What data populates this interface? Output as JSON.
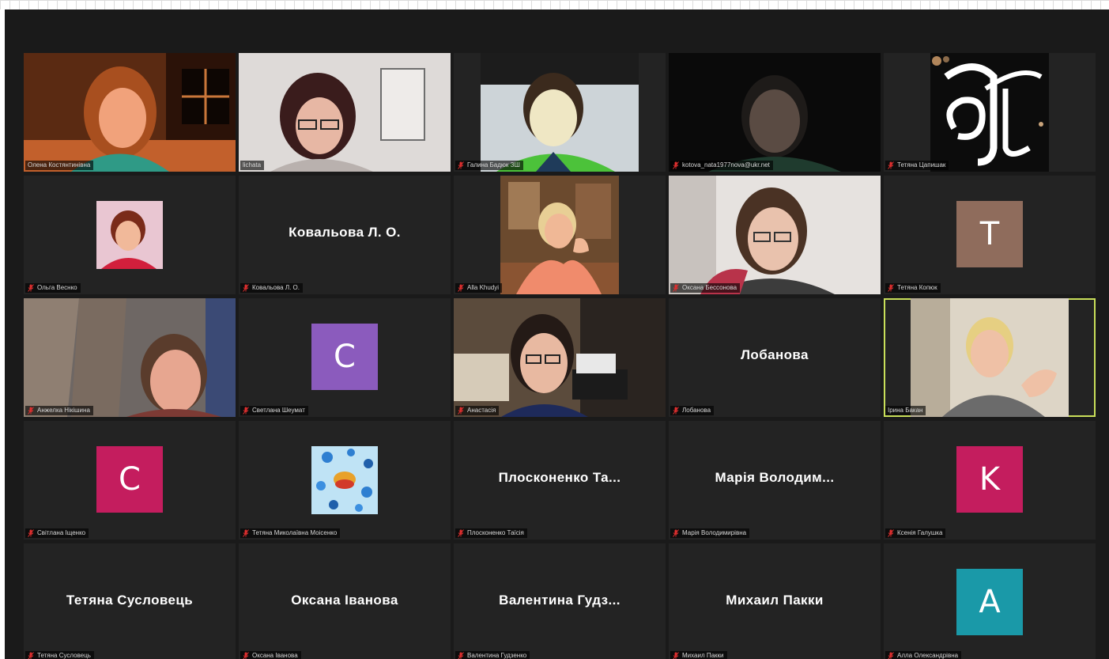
{
  "window": {
    "app": "zoom-gallery-view",
    "accent": "#c9df5a",
    "background": "#1a1a1a",
    "tile_background": "#232323"
  },
  "participants": [
    {
      "tag_name": "Олена Костянтинівна",
      "muted": false,
      "display": "video"
    },
    {
      "tag_name": "lichata",
      "muted": false,
      "display": "video"
    },
    {
      "tag_name": "Галина Бадюк ЗШ",
      "muted": true,
      "display": "video"
    },
    {
      "tag_name": "kotova_nata1977nova@ukr.net",
      "muted": true,
      "display": "video"
    },
    {
      "tag_name": "Тетяна Цапишак",
      "muted": true,
      "display": "video"
    },
    {
      "tag_name": "Ольга Веснко",
      "muted": true,
      "display": "photo"
    },
    {
      "tag_name": "Ковальова Л. О.",
      "muted": true,
      "display": "name",
      "name_label": "Ковальова Л. О."
    },
    {
      "tag_name": "Alla Khudyi",
      "muted": true,
      "display": "video"
    },
    {
      "tag_name": "Оксана Бессонова",
      "muted": true,
      "display": "video"
    },
    {
      "tag_name": "Тетяна Копюк",
      "muted": true,
      "display": "letter",
      "avatar_letter": "T",
      "avatar_color": "#8f6c5c"
    },
    {
      "tag_name": "Анжелка Нікішина",
      "muted": true,
      "display": "video"
    },
    {
      "tag_name": "Светлана Шеумат",
      "muted": true,
      "display": "letter",
      "avatar_letter": "C",
      "avatar_color": "#8b5bbd"
    },
    {
      "tag_name": "Анастасія",
      "muted": true,
      "display": "video"
    },
    {
      "tag_name": "Лобанова",
      "muted": true,
      "display": "name",
      "name_label": "Лобанова"
    },
    {
      "tag_name": "Ірина Бакан",
      "muted": false,
      "display": "video",
      "active_speaker": true
    },
    {
      "tag_name": "Світлана Іщенко",
      "muted": true,
      "display": "letter",
      "avatar_letter": "C",
      "avatar_color": "#c41d5e"
    },
    {
      "tag_name": "Тетяна Миколаївна Моісенко",
      "muted": true,
      "display": "photo"
    },
    {
      "tag_name": "Плосконенко Таїсія",
      "muted": true,
      "display": "name",
      "name_label": "Плосконенко Та..."
    },
    {
      "tag_name": "Марія Володимирівна",
      "muted": true,
      "display": "name",
      "name_label": "Марія Володим..."
    },
    {
      "tag_name": "Ксенія Галушка",
      "muted": true,
      "display": "letter",
      "avatar_letter": "K",
      "avatar_color": "#c41d5e"
    },
    {
      "tag_name": "Тетяна Сусловець",
      "muted": true,
      "display": "name",
      "name_label": "Тетяна Сусловець"
    },
    {
      "tag_name": "Оксана Іванова",
      "muted": true,
      "display": "name",
      "name_label": "Оксана Іванова"
    },
    {
      "tag_name": "Валентина Гудзенко",
      "muted": true,
      "display": "name",
      "name_label": "Валентина Гудз..."
    },
    {
      "tag_name": "Михаил Пакки",
      "muted": true,
      "display": "name",
      "name_label": "Михаил Пакки"
    },
    {
      "tag_name": "Алла Олександрівна",
      "muted": true,
      "display": "letter",
      "avatar_letter": "A",
      "avatar_color": "#1a99a8"
    }
  ]
}
